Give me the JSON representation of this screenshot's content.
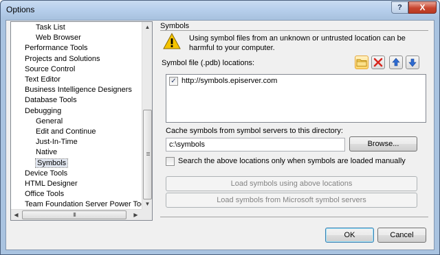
{
  "window": {
    "title": "Options",
    "help_label": "?",
    "close_label": "X"
  },
  "tree": {
    "items": [
      {
        "label": "Task List",
        "level": 1
      },
      {
        "label": "Web Browser",
        "level": 1
      },
      {
        "label": "Performance Tools",
        "level": 0
      },
      {
        "label": "Projects and Solutions",
        "level": 0
      },
      {
        "label": "Source Control",
        "level": 0
      },
      {
        "label": "Text Editor",
        "level": 0
      },
      {
        "label": "Business Intelligence Designers",
        "level": 0
      },
      {
        "label": "Database Tools",
        "level": 0
      },
      {
        "label": "Debugging",
        "level": 0
      },
      {
        "label": "General",
        "level": 1
      },
      {
        "label": "Edit and Continue",
        "level": 1
      },
      {
        "label": "Just-In-Time",
        "level": 1
      },
      {
        "label": "Native",
        "level": 1
      },
      {
        "label": "Symbols",
        "level": 1,
        "selected": true
      },
      {
        "label": "Device Tools",
        "level": 0
      },
      {
        "label": "HTML Designer",
        "level": 0
      },
      {
        "label": "Office Tools",
        "level": 0
      },
      {
        "label": "Team Foundation Server Power Tools",
        "level": 0
      }
    ],
    "hscroll_grip": "III"
  },
  "symbols": {
    "section_title": "Symbols",
    "warning_text": "Using symbol files from an unknown or untrusted location can be harmful to your computer.",
    "locations_label": "Symbol file (.pdb) locations:",
    "locations": [
      {
        "checked": true,
        "url": "http://symbols.episerver.com"
      }
    ],
    "cache_label": "Cache symbols from symbol servers to this directory:",
    "cache_value": "c:\\symbols",
    "browse_label": "Browse...",
    "manual_only_label": "Search the above locations only when symbols are loaded manually",
    "manual_only_checked": false,
    "load_locations_label": "Load symbols using above locations",
    "load_ms_label": "Load symbols from Microsoft symbol servers"
  },
  "footer": {
    "ok_label": "OK",
    "cancel_label": "Cancel"
  },
  "colors": {
    "accent": "#3c7fb1",
    "warning": "#f5c400"
  }
}
